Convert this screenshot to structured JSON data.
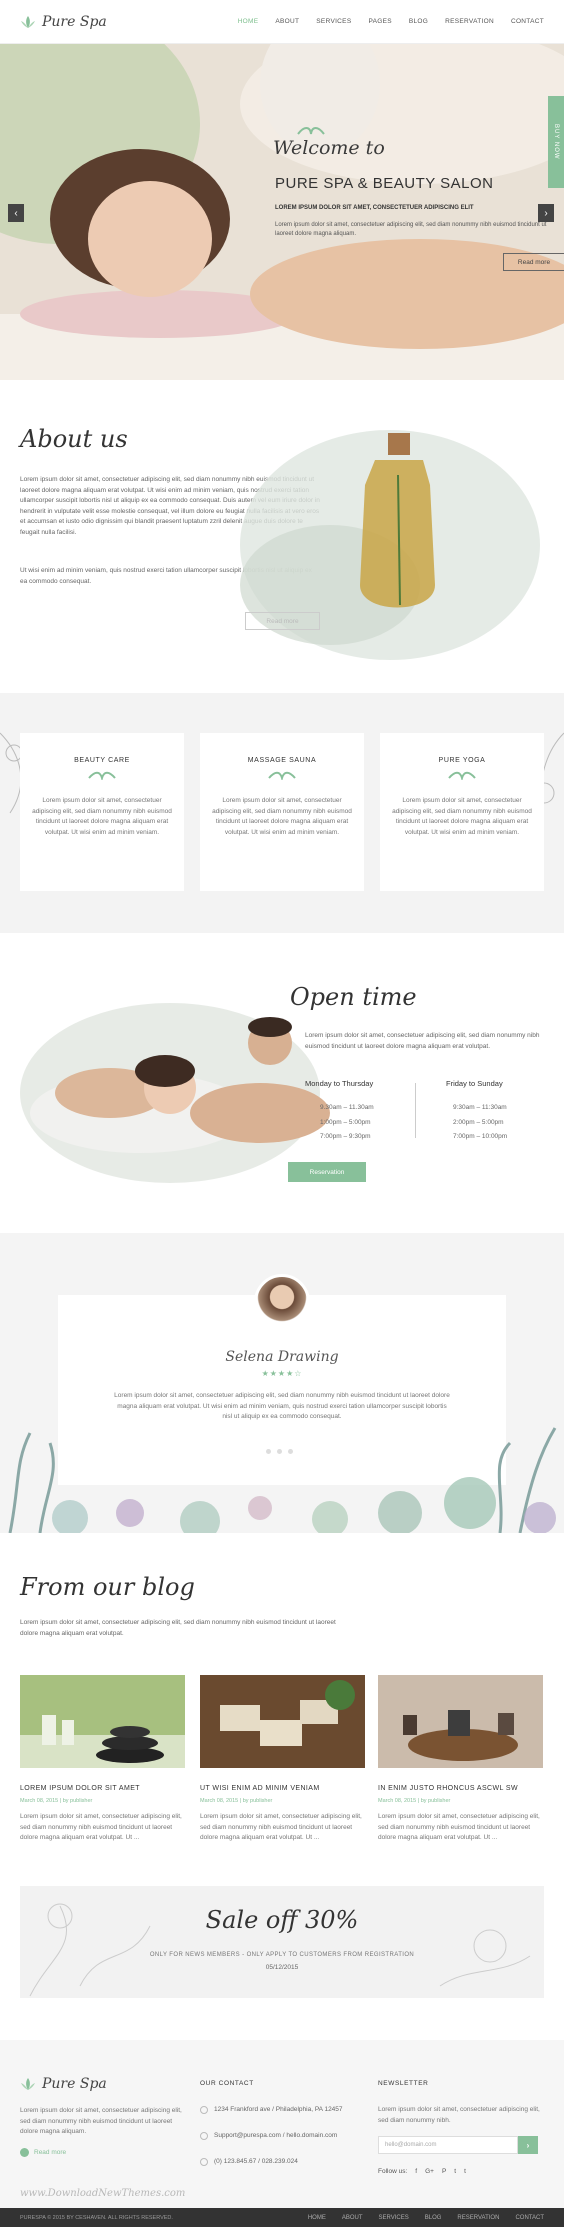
{
  "header": {
    "logo": "Pure Spa",
    "nav": [
      "HOME",
      "ABOUT",
      "SERVICES",
      "PAGES",
      "BLOG",
      "RESERVATION",
      "CONTACT"
    ]
  },
  "hero": {
    "welcome": "Welcome to",
    "title": "PURE SPA & BEAUTY SALON",
    "subtitle": "LOREM IPSUM DOLOR SIT AMET, CONSECTETUER ADIPISCING ELIT",
    "text": "Lorem ipsum dolor sit amet, consectetuer adipiscing elit, sed diam nonummy nibh euismod tincidunt ut laoreet dolore magna aliquam.",
    "read_more": "Read more",
    "buy_now": "BUY NOW",
    "prev_icon": "‹",
    "next_icon": "›"
  },
  "about": {
    "title": "About us",
    "p1": "Lorem ipsum dolor sit amet, consectetuer adipiscing elit, sed diam nonummy nibh euismod tincidunt ut laoreet dolore magna aliquam erat volutpat. Ut wisi enim ad minim veniam, quis nostrud exerci tation ullamcorper suscipit lobortis nisl ut aliquip ex ea commodo consequat. Duis autem vel eum iriure dolor in hendrerit in vulputate velit esse molestie consequat, vel illum dolore eu feugiat nulla facilisis at vero eros et accumsan et iusto odio dignissim qui blandit praesent luptatum zzril delenit augue duis dolore te feugait nulla facilisi.",
    "p2": "Ut wisi enim ad minim veniam, quis nostrud exerci tation ullamcorper suscipit lobortis nisl ut aliquip ex ea commodo consequat.",
    "button": "Read more"
  },
  "services": [
    {
      "title": "BEAUTY CARE",
      "text": "Lorem ipsum dolor sit amet, consectetuer adipiscing elit, sed diam nonummy nibh euismod tincidunt ut laoreet dolore magna aliquam erat volutpat. Ut wisi enim ad minim veniam."
    },
    {
      "title": "MASSAGE SAUNA",
      "text": "Lorem ipsum dolor sit amet, consectetuer adipiscing elit, sed diam nonummy nibh euismod tincidunt ut laoreet dolore magna aliquam erat volutpat. Ut wisi enim ad minim veniam."
    },
    {
      "title": "PURE YOGA",
      "text": "Lorem ipsum dolor sit amet, consectetuer adipiscing elit, sed diam nonummy nibh euismod tincidunt ut laoreet dolore magna aliquam erat volutpat. Ut wisi enim ad minim veniam."
    }
  ],
  "open_time": {
    "title": "Open time",
    "text": "Lorem ipsum dolor sit amet, consectetuer adipiscing elit, sed diam nonummy nibh euismod tincidunt ut laoreet dolore magna aliquam erat volutpat.",
    "weekdays": "Monday to Thursday",
    "weekdays_times": [
      "9.30am – 11.30am",
      "1:00pm – 5:00pm",
      "7:00pm – 9:30pm"
    ],
    "weekend": "Friday to Sunday",
    "weekend_times": [
      "9:30am – 11:30am",
      "2:00pm – 5:00pm",
      "7:00pm – 10:00pm"
    ],
    "button": "Reservation"
  },
  "testimonial": {
    "name": "Selena Drawing",
    "stars": "★★★★☆",
    "text": "Lorem ipsum dolor sit amet, consectetuer adipiscing elit, sed diam nonummy nibh euismod tincidunt ut laoreet dolore magna aliquam erat volutpat. Ut wisi enim ad minim veniam, quis nostrud exerci tation ullamcorper suscipit lobortis nisl ut aliquip ex ea commodo consequat."
  },
  "blog": {
    "title": "From our blog",
    "intro": "Lorem ipsum dolor sit amet, consectetuer adipiscing elit, sed diam nonummy nibh euismod tincidunt ut laoreet dolore magna aliquam erat volutpat.",
    "posts": [
      {
        "title": "LOREM IPSUM DOLOR SIT AMET",
        "meta": "March 08, 2015  |  by publisher",
        "excerpt": "Lorem ipsum dolor sit amet, consectetuer adipiscing elit, sed diam nonummy nibh euismod tincidunt ut laoreet dolore magna aliquam erat volutpat. Ut ..."
      },
      {
        "title": "UT WISI ENIM AD MINIM VENIAM",
        "meta": "March 08, 2015  |  by publisher",
        "excerpt": "Lorem ipsum dolor sit amet, consectetuer adipiscing elit, sed diam nonummy nibh euismod tincidunt ut laoreet dolore magna aliquam erat volutpat. Ut ..."
      },
      {
        "title": "IN ENIM JUSTO RHONCUS ASCWL SW",
        "meta": "March 08, 2015  |  by publisher",
        "excerpt": "Lorem ipsum dolor sit amet, consectetuer adipiscing elit, sed diam nonummy nibh euismod tincidunt ut laoreet dolore magna aliquam erat volutpat. Ut ..."
      }
    ]
  },
  "sale": {
    "title": "Sale off 30%",
    "subtitle": "ONLY FOR NEWS MEMBERS - ONLY APPLY TO CUSTOMERS FROM REGISTRATION",
    "date": "05/12/2015"
  },
  "footer": {
    "logo": "Pure Spa",
    "about": "Lorem ipsum dolor sit amet, consectetuer adipiscing elit, sed diam nonummy nibh euismod tincidunt ut laoreet dolore magna aliquam.",
    "read_more": "Read more",
    "contact_title": "OUR CONTACT",
    "address": "1234 Frankford ave / Philadelphia, PA 12457",
    "email": "Support@purespa.com / hello.domain.com",
    "phone": "(0) 123.845.67 / 028.239.024",
    "newsletter_title": "NEWSLETTER",
    "newsletter_text": "Lorem ipsum dolor sit amet, consectetuer adipiscing elit, sed diam nonummy nibh.",
    "email_placeholder": "hello@domain.com",
    "follow": "Follow us:",
    "social": [
      "f",
      "G+",
      "P",
      "t",
      "t"
    ],
    "copyright": "PURESPA © 2015 BY CESHAVEN. ALL RIGHTS RESERVED.",
    "bottom_nav": [
      "HOME",
      "ABOUT",
      "SERVICES",
      "BLOG",
      "RESERVATION",
      "CONTACT"
    ],
    "watermark": "www.DownloadNewThemes.com"
  },
  "colors": {
    "accent": "#88c09a",
    "dark": "#333333"
  }
}
